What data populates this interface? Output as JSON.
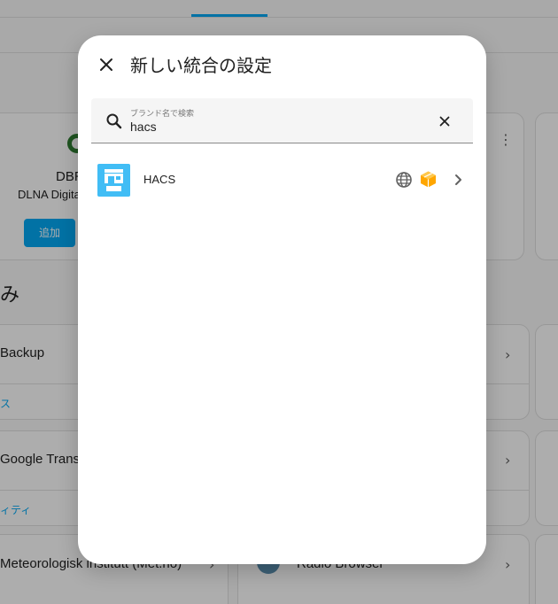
{
  "background": {
    "dlna_card": {
      "name": "DBR",
      "description": "DLNA Digita",
      "add_button": "追加"
    },
    "section_title": "み",
    "items": [
      {
        "label": "Backup",
        "sub": "ス"
      },
      {
        "label": "Google Transl",
        "sub": "ィティ"
      },
      {
        "label": "Meteorologisk institutt (Met.no)"
      },
      {
        "label": "Radio Browser"
      }
    ]
  },
  "dialog": {
    "title": "新しい統合の設定",
    "search": {
      "label": "ブランド名で検索",
      "value": "hacs"
    },
    "results": [
      {
        "name": "HACS",
        "badges": [
          "globe-icon",
          "cube-icon"
        ],
        "logo_color": "#41bdf5"
      }
    ]
  },
  "colors": {
    "accent": "#03a9f4",
    "custom_badge": "#ffa600"
  }
}
